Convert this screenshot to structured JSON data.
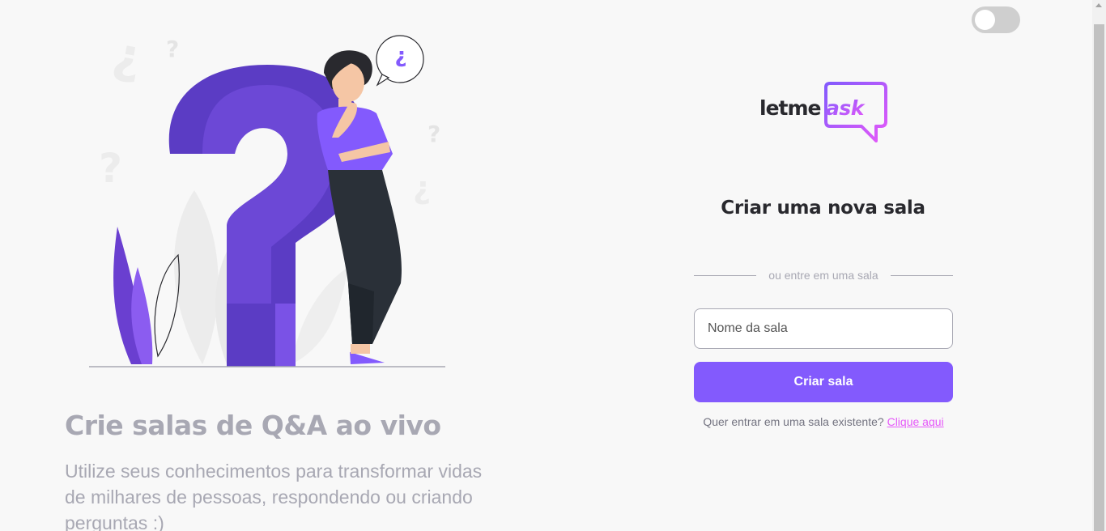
{
  "theme_toggle": {
    "state": "off"
  },
  "hero": {
    "title": "Crie salas de Q&A ao vivo",
    "text": "Utilize seus conhecimentos para transformar vidas de milhares de pessoas, respondendo ou criando perguntas :)"
  },
  "logo": {
    "part1": "letme",
    "part2": "ask"
  },
  "form": {
    "title": "Criar uma nova sala",
    "divider": "ou entre em uma sala",
    "input_placeholder": "Nome da sala",
    "input_value": "",
    "button_label": "Criar sala",
    "existing_prompt": "Quer entrar em uma sala existente?",
    "existing_link": "Clique aqui"
  },
  "bubble_glyph": "¿",
  "colors": {
    "primary": "#835afd",
    "accent": "#e559f9",
    "muted": "#a8a8b3",
    "text": "#29292e"
  }
}
